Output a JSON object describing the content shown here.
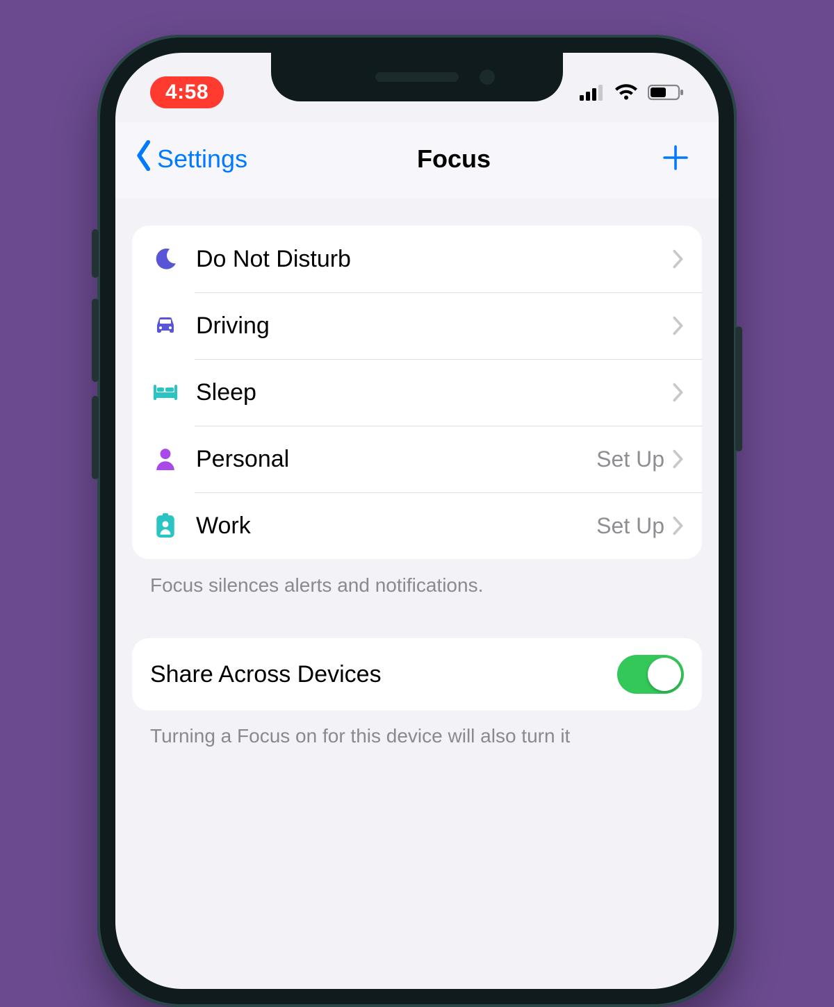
{
  "status": {
    "time": "4:58",
    "recording": true
  },
  "nav": {
    "back_label": "Settings",
    "title": "Focus"
  },
  "focus_modes": [
    {
      "id": "dnd",
      "label": "Do Not Disturb",
      "trailing": "",
      "icon": "moon",
      "icon_color": "#5856d6"
    },
    {
      "id": "driving",
      "label": "Driving",
      "trailing": "",
      "icon": "car",
      "icon_color": "#5856d6"
    },
    {
      "id": "sleep",
      "label": "Sleep",
      "trailing": "",
      "icon": "bed",
      "icon_color": "#2bc4c4"
    },
    {
      "id": "personal",
      "label": "Personal",
      "trailing": "Set Up",
      "icon": "person",
      "icon_color": "#a94ae8"
    },
    {
      "id": "work",
      "label": "Work",
      "trailing": "Set Up",
      "icon": "badge",
      "icon_color": "#2bc4c4"
    }
  ],
  "footer_note": "Focus silences alerts and notifications.",
  "share": {
    "label": "Share Across Devices",
    "enabled": true,
    "note": "Turning a Focus on for this device will also turn it"
  },
  "colors": {
    "tint": "#007aff",
    "toggle_on": "#34c759",
    "recording_pill": "#ff3b30"
  }
}
